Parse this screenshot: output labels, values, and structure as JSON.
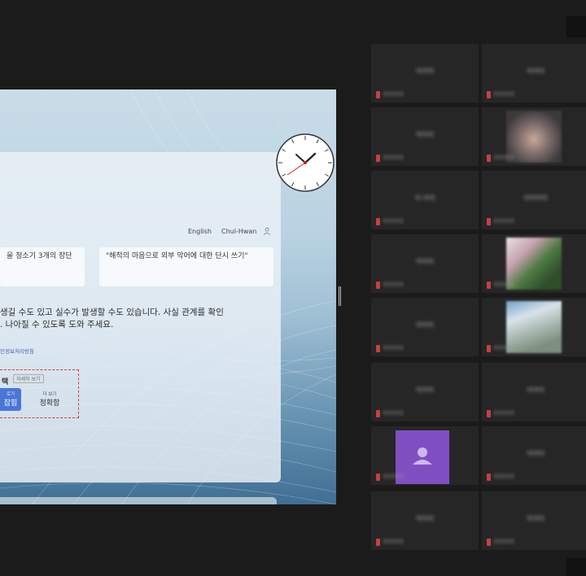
{
  "shared_screen": {
    "language_link": "English",
    "user_name": "Chul-Hwan",
    "suggestions": [
      "을 청소기 3개의 장단",
      "\"해적의 마음으로 외부 악어에 대한 단시 쓰기\""
    ],
    "disclaimer_line1": "생길 수도 있고 실수가 발생할 수도 있습니다. 사실 관계를 확인",
    "disclaimer_line2": ". 나아질 수 있도록 도와 주세요.",
    "privacy_link": "인정보처리방침",
    "style_section": {
      "title": "택",
      "more_label": "자세히 보기",
      "options": [
        {
          "small": "로기",
          "main": "잡힘",
          "selected": true
        },
        {
          "small": "더 보기",
          "main": "정확함",
          "selected": false
        }
      ]
    }
  },
  "participants": [
    {
      "name": "이이이",
      "sub": "이이이이"
    },
    {
      "name": "이이이",
      "sub": "이이이이"
    },
    {
      "name": "이이이",
      "sub": "이이이이"
    },
    {
      "name": "",
      "sub": "이이이이",
      "has_photo": true
    },
    {
      "name": "이 이이",
      "sub": "이이이이"
    },
    {
      "name": "이이이이",
      "sub": "이이이이"
    },
    {
      "name": "이이이",
      "sub": "이이이이"
    },
    {
      "name": "",
      "sub": "이이이이",
      "has_photo": true
    },
    {
      "name": "이이이",
      "sub": "이이이이"
    },
    {
      "name": "",
      "sub": "이이이이",
      "has_photo": true
    },
    {
      "name": "이이이",
      "sub": "이이이이"
    },
    {
      "name": "이이이",
      "sub": "이이이이"
    },
    {
      "name": "",
      "sub": "이이이이",
      "has_avatar": true
    },
    {
      "name": "이이이",
      "sub": "이이이이"
    },
    {
      "name": "이이이",
      "sub": "이이이이"
    },
    {
      "name": "이이이",
      "sub": "이이이이"
    }
  ],
  "colors": {
    "background": "#1b1b1b",
    "tile": "#262626",
    "mic_muted": "#c8403e",
    "avatar": "#7f4fc2",
    "accent_button": "#4c75d8"
  }
}
